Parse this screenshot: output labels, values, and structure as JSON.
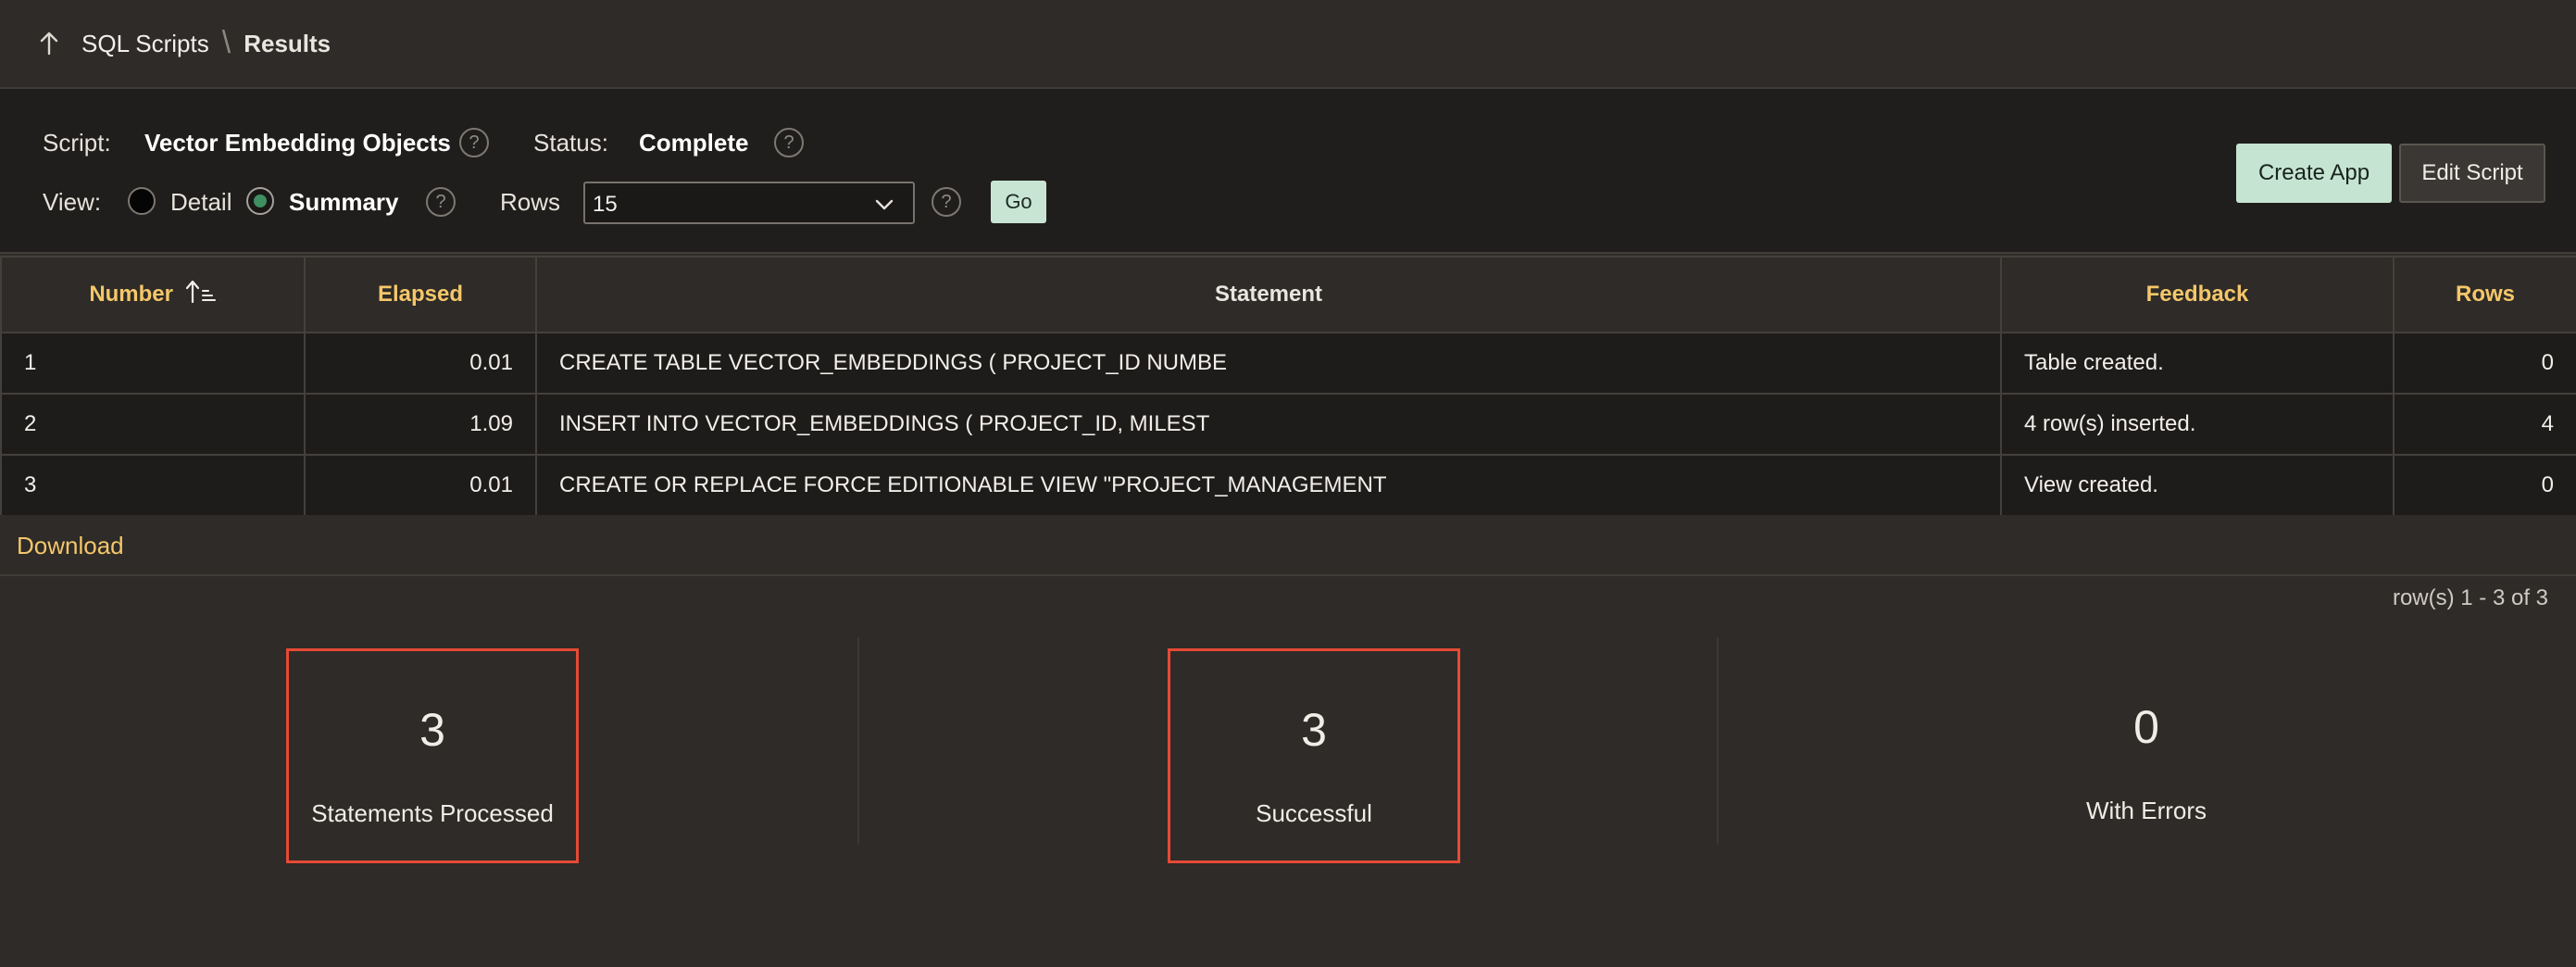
{
  "breadcrumb": {
    "parent": "SQL Scripts",
    "current": "Results"
  },
  "controls": {
    "script_label": "Script:",
    "script_value": "Vector Embedding Objects",
    "status_label": "Status:",
    "status_value": "Complete",
    "view_label": "View:",
    "view_options": [
      "Detail",
      "Summary"
    ],
    "view_selected": "Summary",
    "rows_label": "Rows",
    "rows_value": "15",
    "go_label": "Go",
    "help_glyph": "?"
  },
  "buttons": {
    "create_app": "Create App",
    "edit_script": "Edit Script"
  },
  "table": {
    "columns": [
      "Number",
      "Elapsed",
      "Statement",
      "Feedback",
      "Rows"
    ],
    "rows": [
      [
        "1",
        "0.01",
        "CREATE TABLE VECTOR_EMBEDDINGS ( PROJECT_ID NUMBE",
        "Table created.",
        "0"
      ],
      [
        "2",
        "1.09",
        "INSERT INTO VECTOR_EMBEDDINGS ( PROJECT_ID, MILEST",
        "4 row(s) inserted.",
        "4"
      ],
      [
        "3",
        "0.01",
        "CREATE OR REPLACE FORCE EDITIONABLE VIEW \"PROJECT_MANAGEMENT",
        "View created.",
        "0"
      ]
    ],
    "sorted_column": "Number",
    "sort_direction": "ascending"
  },
  "footer": {
    "download": "Download",
    "pagination": "row(s) 1 - 3 of 3"
  },
  "summary": {
    "statements_processed": {
      "value": "3",
      "label": "Statements Processed"
    },
    "successful": {
      "value": "3",
      "label": "Successful"
    },
    "with_errors": {
      "value": "0",
      "label": "With Errors"
    }
  },
  "colors": {
    "background": "#2e2b28",
    "panel": "#201e1c",
    "accent_link": "#f5c76a",
    "primary_button": "#c6e4d2",
    "highlight_box": "#e64a35",
    "radio_selected": "#3f8f61"
  },
  "icons": [
    "arrow-up-icon",
    "help-icon",
    "chevron-down-icon",
    "sort-ascending-icon"
  ]
}
